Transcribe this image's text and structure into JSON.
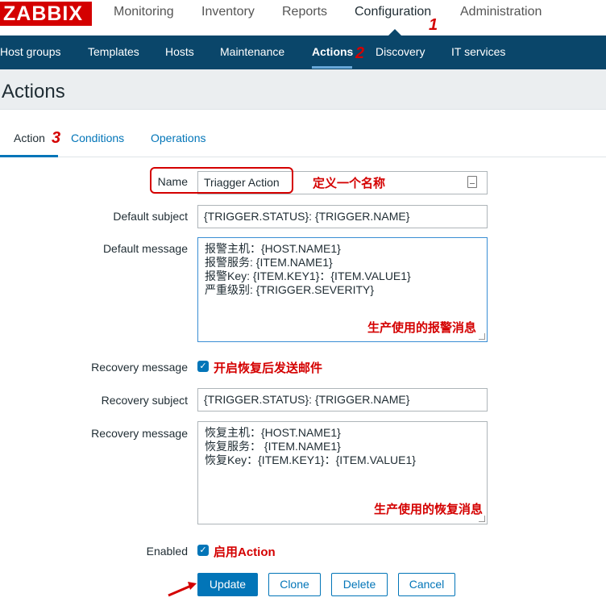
{
  "logo": "ZABBIX",
  "top_menu": [
    "Monitoring",
    "Inventory",
    "Reports",
    "Configuration",
    "Administration"
  ],
  "sub_menu": [
    "Host groups",
    "Templates",
    "Hosts",
    "Maintenance",
    "Actions",
    "Discovery",
    "IT services"
  ],
  "page_title": "Actions",
  "tabs": [
    "Action",
    "Conditions",
    "Operations"
  ],
  "markers": [
    "1",
    "2",
    "3"
  ],
  "form": {
    "name_label": "Name",
    "name_value": "Triagger  Action",
    "default_subject_label": "Default subject",
    "default_subject_value": "{TRIGGER.STATUS}: {TRIGGER.NAME}",
    "default_message_label": "Default message",
    "default_message_lines": [
      "报警主机：{HOST.NAME1}",
      "报警服务: {ITEM.NAME1}",
      "报警Key: {ITEM.KEY1}：{ITEM.VALUE1}",
      "严重级别: {TRIGGER.SEVERITY}"
    ],
    "recovery_message_check_label": "Recovery message",
    "recovery_subject_label": "Recovery subject",
    "recovery_subject_value": "{TRIGGER.STATUS}: {TRIGGER.NAME}",
    "recovery_message_label": "Recovery message",
    "recovery_message_lines": [
      "恢复主机：{HOST.NAME1}",
      "恢复服务：  {ITEM.NAME1}",
      "恢复Key：{ITEM.KEY1}：{ITEM.VALUE1}"
    ],
    "enabled_label": "Enabled"
  },
  "annotations": {
    "name_note": "定义一个名称",
    "default_message_note": "生产使用的报警消息",
    "recovery_check_note": "开启恢复后发送邮件",
    "recovery_message_note": "生产使用的恢复消息",
    "enabled_note": "启用Action"
  },
  "buttons": {
    "update": "Update",
    "clone": "Clone",
    "delete": "Delete",
    "cancel": "Cancel"
  },
  "colors": {
    "brand_red": "#d40000",
    "nav_blue": "#0a466a",
    "accent_blue": "#0275b8"
  }
}
